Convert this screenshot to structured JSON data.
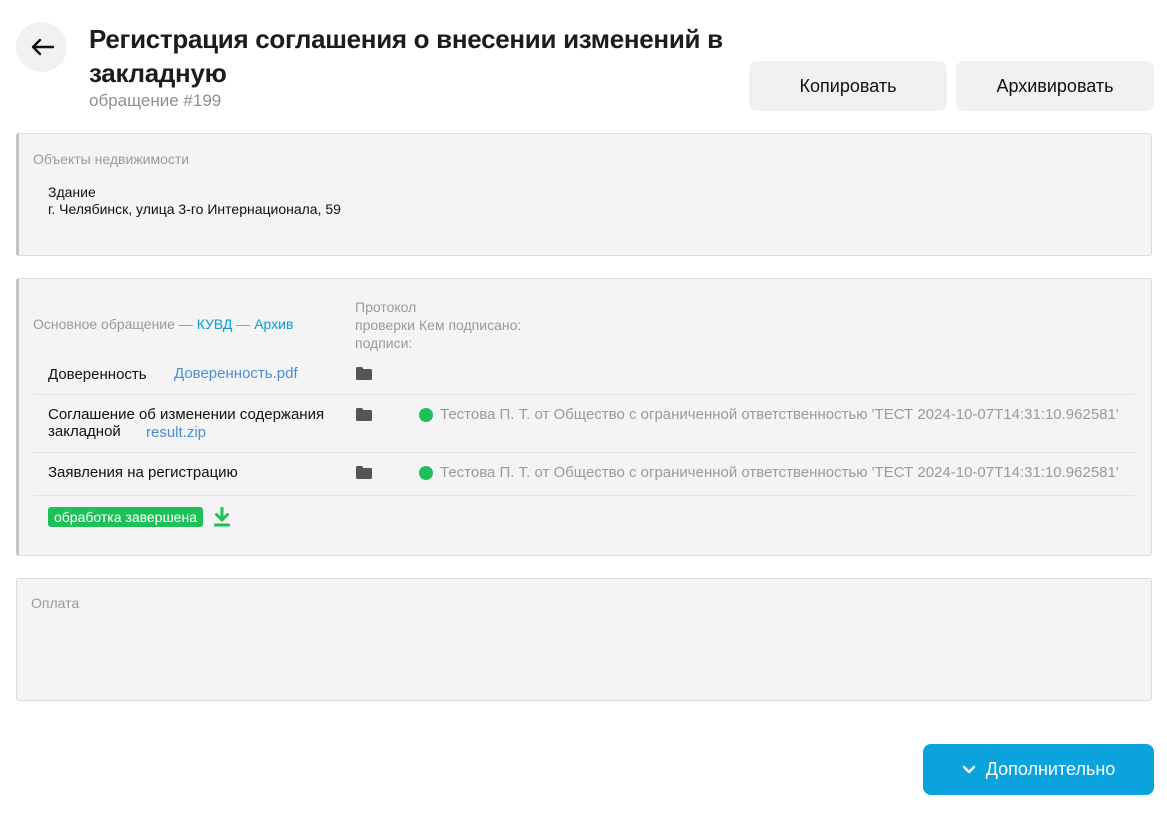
{
  "header": {
    "title": "Регистрация соглашения о внесении изменений в закладную",
    "subtitle": "обращение #199",
    "copy_label": "Копировать",
    "archive_label": "Архивировать"
  },
  "objects": {
    "title": "Объекты недвижимости",
    "type": "Здание",
    "address": "г. Челябинск, улица 3-го Интернационала, 59"
  },
  "documents": {
    "main_label": "Основное обращение",
    "kuvd_link": "КУВД",
    "archive_link": "Архив",
    "col_protocol": "Протокол проверки подписи:",
    "col_signed": "Кем подписано:",
    "rows": [
      {
        "label": "Доверенность",
        "file": "Доверенность.pdf",
        "signature": ""
      },
      {
        "label": "Соглашение об изменении содержания закладной",
        "file": "result.zip",
        "signature": "Тестова П. Т. от Общество с ограниченной ответственностью 'ТЕСТ 2024-10-07T14:31:10.962581'"
      },
      {
        "label": "Заявления на регистрацию",
        "file": "",
        "signature": "Тестова П. Т. от Общество с ограниченной ответственностью 'ТЕСТ 2024-10-07T14:31:10.962581'"
      }
    ],
    "status": "обработка завершена"
  },
  "payment": {
    "title": "Оплата"
  },
  "footer": {
    "more_label": "Дополнительно"
  },
  "colors": {
    "accent": "#0aa3dd",
    "success": "#1fc05a",
    "link": "#4a8fd6"
  },
  "icons": [
    "arrow-left-icon",
    "folder-icon",
    "download-icon",
    "chevron-down-icon"
  ]
}
